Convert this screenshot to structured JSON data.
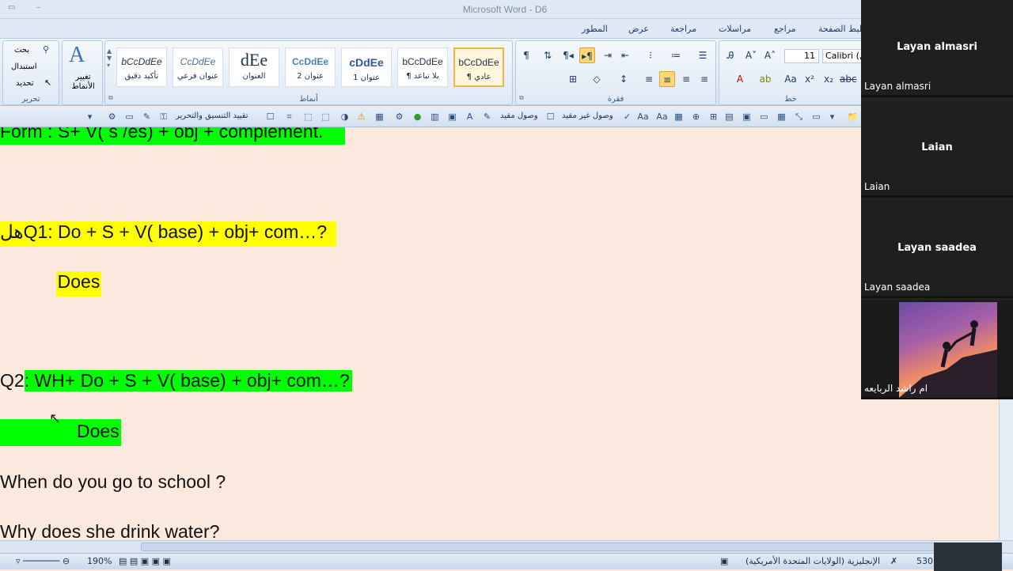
{
  "window": {
    "title": "Microsoft Word - D6"
  },
  "tabs": [
    "المطور",
    "عرض",
    "مراجعة",
    "مراسلات",
    "مراجع",
    "تخطيط الصفحة"
  ],
  "ribbon": {
    "edit_group": {
      "label": "تحرير",
      "find": "بحث",
      "replace": "استبدال",
      "select": "تحديد"
    },
    "change_styles": {
      "label": "تغيير الأنماط"
    },
    "styles_group": {
      "label": "أنماط",
      "styles": [
        {
          "sample": "bCcDdEe",
          "name": "تأكيد دقيق"
        },
        {
          "sample": "CcDdEe",
          "name": "عنوان فرعي"
        },
        {
          "sample": "dEe",
          "name": "العنوان"
        },
        {
          "sample": "CcDdEe",
          "name": "عنوان 2"
        },
        {
          "sample": "cDdEe",
          "name": "عنوان 1"
        },
        {
          "sample": "bCcDdEe",
          "name": "¶ بلا تباعد"
        },
        {
          "sample": "bCcDdEe",
          "name": "¶ عادي"
        }
      ]
    },
    "paragraph_group": {
      "label": "فقرة"
    },
    "font_group": {
      "label": "خط",
      "size": "11",
      "font": "Calibri (ال"
    }
  },
  "toolbar2": {
    "restrict": "تقييد التنسيق والتحرير",
    "linked_unrestricted": "وصول غير مقيد",
    "linked_restricted": "وصول مقيد"
  },
  "document": {
    "lines": [
      {
        "text": "Form : S+ V( s /es) + obj + complement.",
        "hl": "green"
      },
      {
        "text": "Q1: Do  + S + V( base) + obj+ com…?",
        "prefix": "هل",
        "hl": "yellow"
      },
      {
        "text": "Does",
        "hl": "yellow"
      },
      {
        "prefix": "Q2",
        "text": ": WH+ Do  + S + V( base) + obj+ com…?",
        "hl": "green"
      },
      {
        "text": "Does",
        "hl": "green"
      },
      {
        "text": "When do you go to school ?",
        "hl": "none"
      },
      {
        "text": "Why does she drink water?",
        "hl": "none"
      }
    ]
  },
  "statusbar": {
    "zoom": "190%",
    "language": "الإنجليزية (الولايات المتحدة الأمريكية)",
    "words": "530"
  },
  "participants": [
    {
      "display": "Layan almasri",
      "name": "Layan almasri"
    },
    {
      "display": "Laian",
      "name": "Laian"
    },
    {
      "display": "Layan saadea",
      "name": "Layan saadea"
    },
    {
      "display": "",
      "name": "ام راشد الربايعه"
    }
  ]
}
